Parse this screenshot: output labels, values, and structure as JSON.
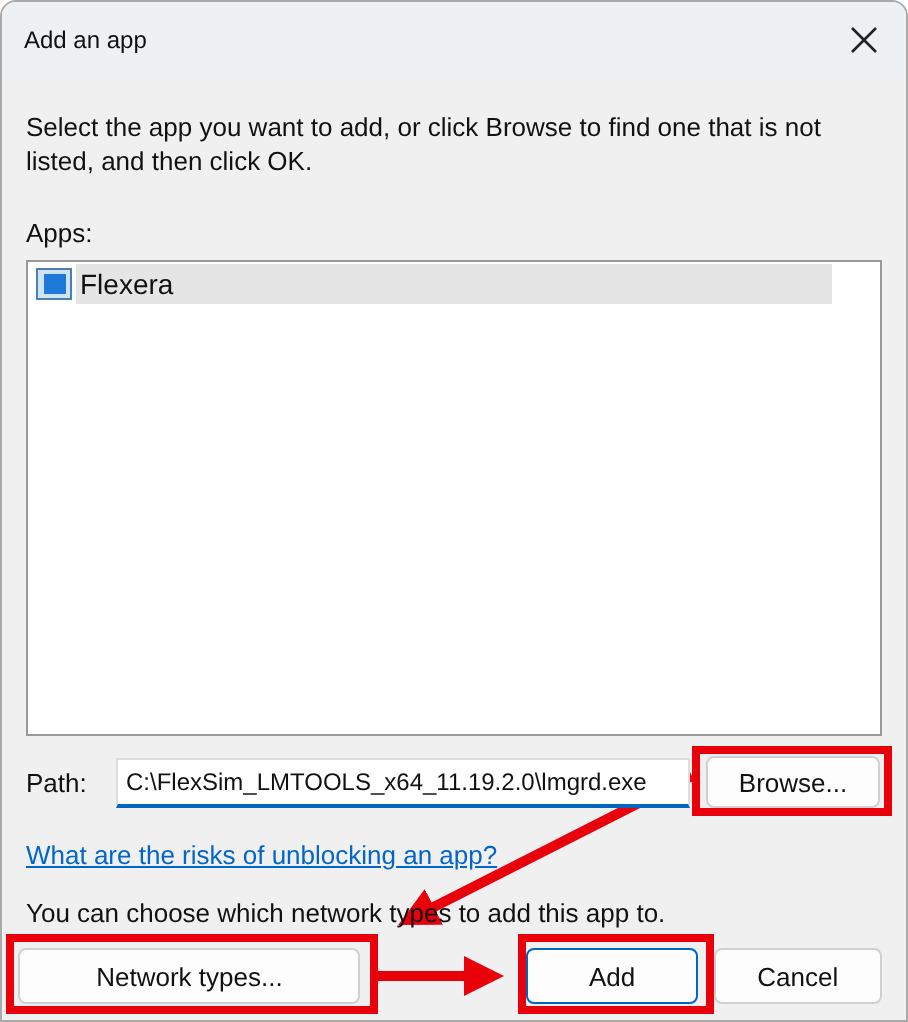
{
  "window": {
    "title": "Add an app"
  },
  "instructions": "Select the app you want to add, or click Browse to find one that is not listed, and then click OK.",
  "apps_label": "Apps:",
  "apps": [
    {
      "name": "Flexera",
      "selected": true
    }
  ],
  "path": {
    "label": "Path:",
    "value": "C:\\FlexSim_LMTOOLS_x64_11.19.2.0\\lmgrd.exe"
  },
  "browse_button": "Browse...",
  "link": "What are the risks of unblocking an app?",
  "network_note": "You can choose which network types to add this app to.",
  "buttons": [
    {
      "label": "Network types...",
      "default": false
    },
    {
      "label": "Add",
      "default": true
    },
    {
      "label": "Cancel",
      "default": false
    }
  ]
}
